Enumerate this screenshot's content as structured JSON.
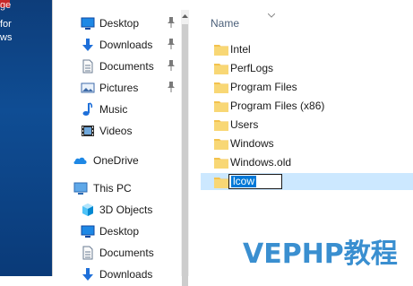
{
  "desktop": {
    "lines": [
      "ge",
      "for",
      "ws"
    ]
  },
  "nav": {
    "quick_access": [
      {
        "label": "Desktop",
        "icon": "desktop-folder-icon",
        "pinned": true
      },
      {
        "label": "Downloads",
        "icon": "downloads-icon",
        "pinned": true
      },
      {
        "label": "Documents",
        "icon": "documents-icon",
        "pinned": true
      },
      {
        "label": "Pictures",
        "icon": "pictures-icon",
        "pinned": true
      },
      {
        "label": "Music",
        "icon": "music-icon",
        "pinned": false
      },
      {
        "label": "Videos",
        "icon": "videos-icon",
        "pinned": false
      }
    ],
    "onedrive": {
      "label": "OneDrive",
      "icon": "onedrive-icon"
    },
    "this_pc": {
      "label": "This PC",
      "icon": "this-pc-icon",
      "items": [
        {
          "label": "3D Objects",
          "icon": "3d-objects-icon"
        },
        {
          "label": "Desktop",
          "icon": "desktop-folder-icon"
        },
        {
          "label": "Documents",
          "icon": "documents-icon"
        },
        {
          "label": "Downloads",
          "icon": "downloads-icon"
        }
      ]
    }
  },
  "content": {
    "column_header": "Name",
    "files": [
      {
        "name": "Intel"
      },
      {
        "name": "PerfLogs"
      },
      {
        "name": "Program Files"
      },
      {
        "name": "Program Files (x86)"
      },
      {
        "name": "Users"
      },
      {
        "name": "Windows"
      },
      {
        "name": "Windows.old"
      }
    ],
    "renaming": {
      "value": "lcow"
    }
  },
  "watermark": "VEPHP教程",
  "colors": {
    "folder": "#f3c24d",
    "selection": "#cce8ff",
    "text_selection": "#0078d7",
    "watermark": "#3a8fd0",
    "header_text": "#4c607a"
  }
}
